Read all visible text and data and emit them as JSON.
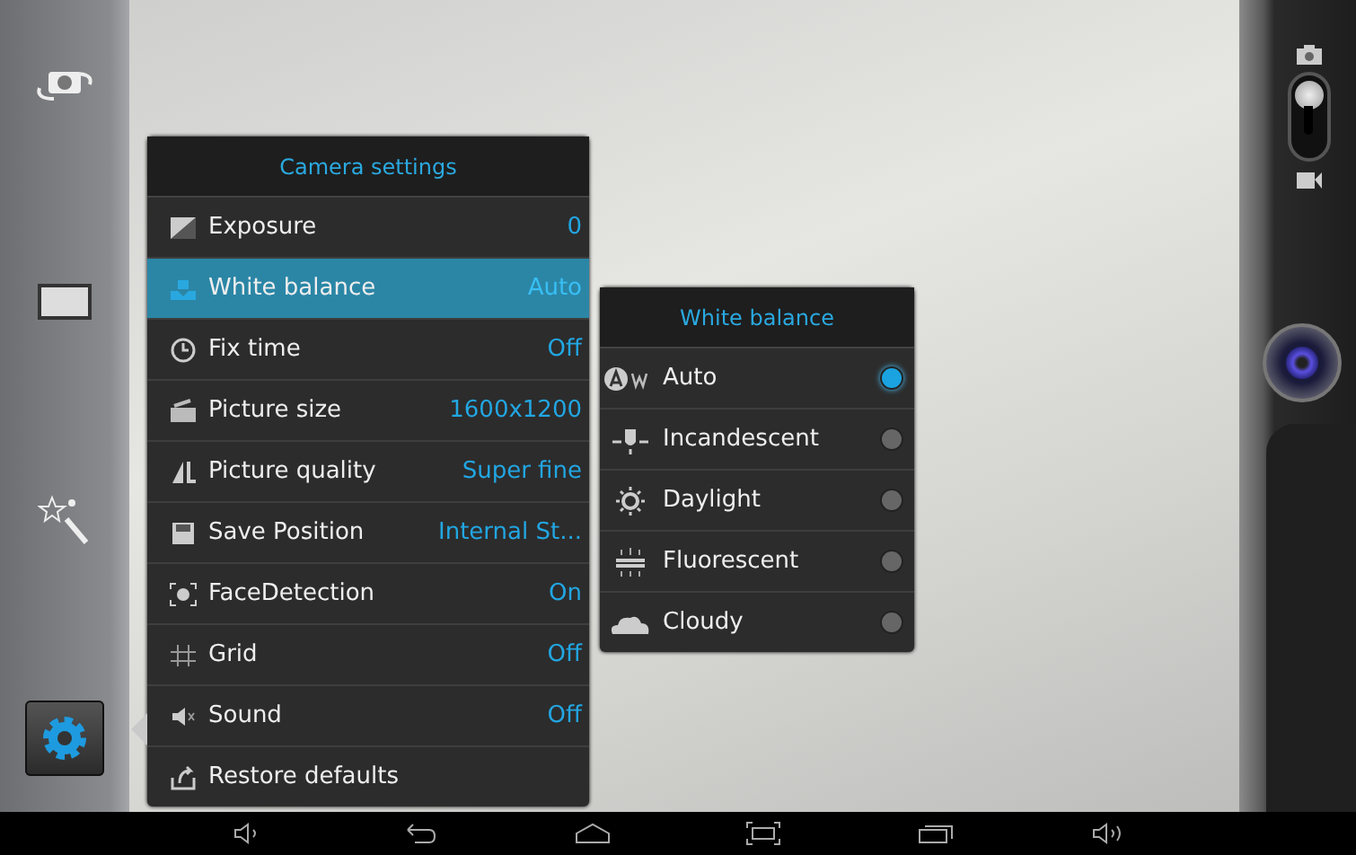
{
  "side_tools": [
    {
      "kind": "switch-camera",
      "selected": false
    },
    {
      "kind": "aspect",
      "selected": false
    },
    {
      "kind": "effects",
      "selected": false
    },
    {
      "kind": "settings",
      "selected": true
    }
  ],
  "camera_settings": {
    "title": "Camera settings",
    "items": [
      {
        "kind": "exposure",
        "label": "Exposure",
        "value": "0",
        "selected": false
      },
      {
        "kind": "white-balance",
        "label": "White balance",
        "value": "Auto",
        "selected": true
      },
      {
        "kind": "timer",
        "label": "Fix time",
        "value": "Off",
        "selected": false
      },
      {
        "kind": "size",
        "label": "Picture size",
        "value": "1600x1200",
        "selected": false
      },
      {
        "kind": "quality",
        "label": "Picture quality",
        "value": "Super fine",
        "selected": false
      },
      {
        "kind": "save",
        "label": "Save Position",
        "value": "Internal St...",
        "selected": false
      },
      {
        "kind": "face",
        "label": "FaceDetection",
        "value": "On",
        "selected": false
      },
      {
        "kind": "grid",
        "label": "Grid",
        "value": "Off",
        "selected": false
      },
      {
        "kind": "sound",
        "label": "Sound",
        "value": "Off",
        "selected": false
      },
      {
        "kind": "restore",
        "label": "Restore defaults",
        "selected": false
      }
    ]
  },
  "white_balance": {
    "title": "White balance",
    "options": [
      {
        "kind": "auto",
        "label": "Auto",
        "selected": true
      },
      {
        "kind": "incandescent",
        "label": "Incandescent",
        "selected": false
      },
      {
        "kind": "daylight",
        "label": "Daylight",
        "selected": false
      },
      {
        "kind": "fluorescent",
        "label": "Fluorescent",
        "selected": false
      },
      {
        "kind": "cloudy",
        "label": "Cloudy",
        "selected": false
      }
    ]
  },
  "mode_switch": {
    "on": false
  },
  "nav_bar": [
    {
      "kind": "volume-down"
    },
    {
      "kind": "back"
    },
    {
      "kind": "home"
    },
    {
      "kind": "screenshot"
    },
    {
      "kind": "recents"
    },
    {
      "kind": "volume-up"
    }
  ]
}
